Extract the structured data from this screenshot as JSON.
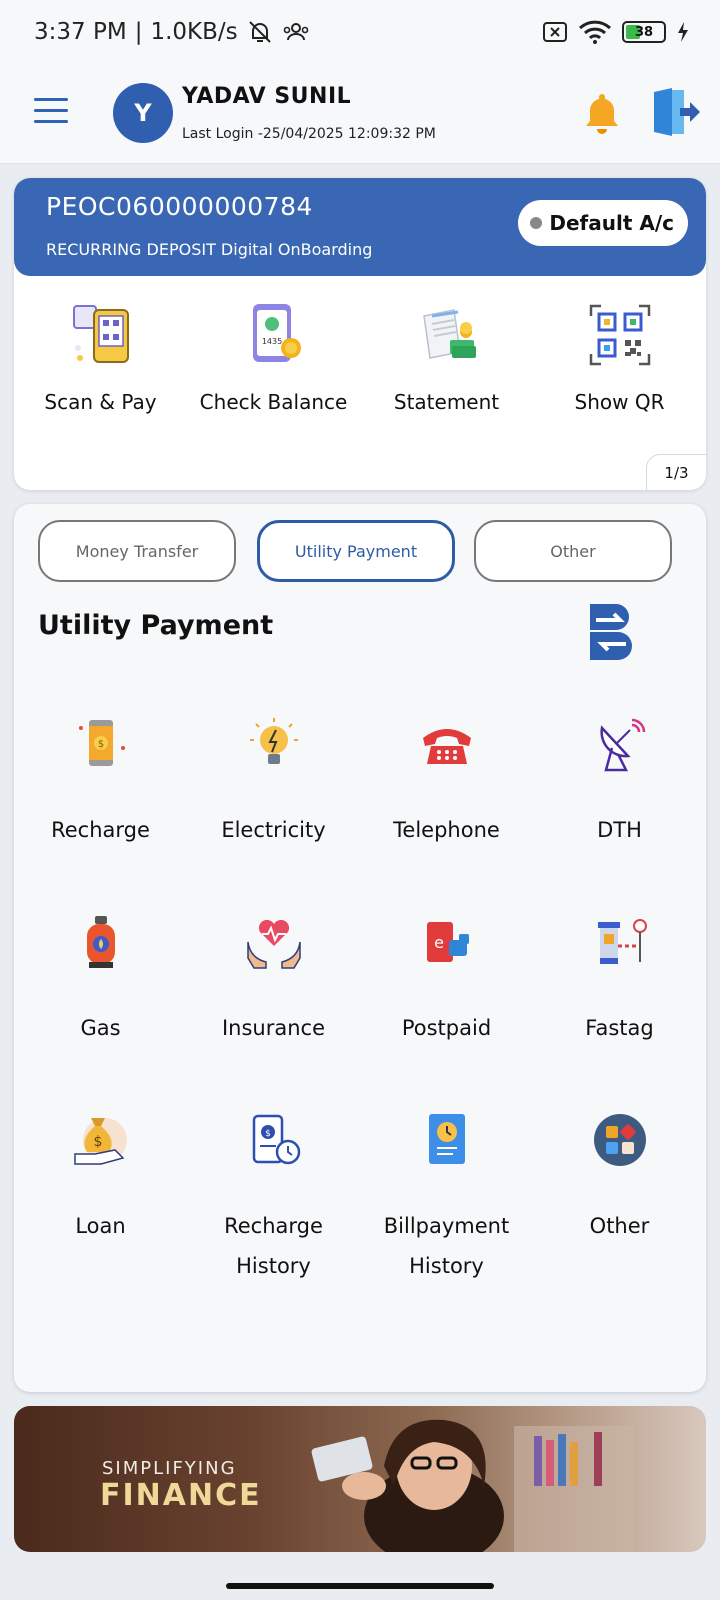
{
  "status_bar": {
    "time": "3:37 PM",
    "speed": "1.0KB/s",
    "battery": "38"
  },
  "header": {
    "avatar_initial": "Y",
    "user_name": "YADAV SUNIL",
    "last_login": "Last Login -25/04/2025 12:09:32 PM"
  },
  "account": {
    "number": "PEOC060000000784",
    "type": "RECURRING DEPOSIT Digital OnBoarding",
    "default_label": "Default A/c",
    "pager": "1/3",
    "quick_actions": [
      {
        "label": "Scan & Pay",
        "icon": "scan-pay-icon"
      },
      {
        "label": "Check Balance",
        "icon": "check-balance-icon"
      },
      {
        "label": "Statement",
        "icon": "statement-icon"
      },
      {
        "label": "Show QR",
        "icon": "qr-code-icon"
      }
    ]
  },
  "tabs": [
    "Money Transfer",
    "Utility Payment",
    "Other"
  ],
  "active_tab": "Utility Payment",
  "section_title": "Utility Payment",
  "services": [
    {
      "label": "Recharge",
      "icon": "mobile-recharge-icon"
    },
    {
      "label": "Electricity",
      "icon": "bulb-icon"
    },
    {
      "label": "Telephone",
      "icon": "telephone-icon"
    },
    {
      "label": "DTH",
      "icon": "satellite-dish-icon"
    },
    {
      "label": "Gas",
      "icon": "gas-cylinder-icon"
    },
    {
      "label": "Insurance",
      "icon": "insurance-icon"
    },
    {
      "label": "Postpaid",
      "icon": "postpaid-icon"
    },
    {
      "label": "Fastag",
      "icon": "toll-gate-icon"
    },
    {
      "label": "Loan",
      "icon": "money-bag-icon"
    },
    {
      "label": "Recharge",
      "label2": "History",
      "icon": "recharge-history-icon"
    },
    {
      "label": "Billpayment",
      "label2": "History",
      "icon": "bill-history-icon"
    },
    {
      "label": "Other",
      "icon": "apps-grid-icon"
    }
  ],
  "promo": {
    "line1": "SIMPLIFYING",
    "line2": "FINANCE"
  },
  "colors": {
    "primary": "#3a67b3",
    "accent": "#2e5aa6",
    "bell": "#f5a623"
  }
}
